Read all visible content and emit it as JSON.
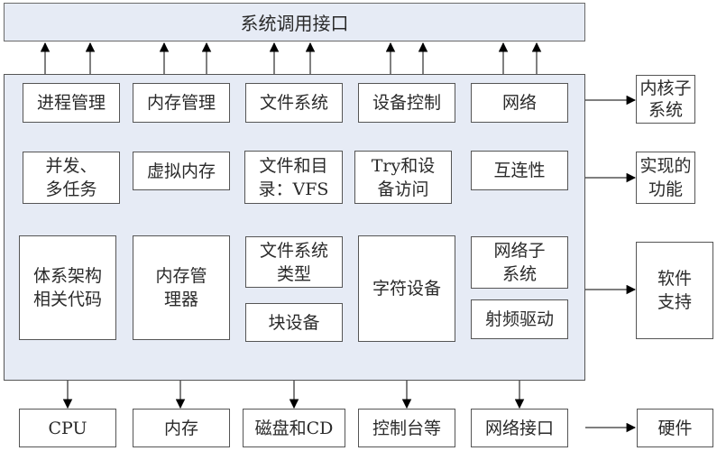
{
  "title": "系统调用接口",
  "kernel_columns": [
    {
      "header": "进程管理",
      "feature": [
        "并发、",
        "多任务"
      ],
      "software": [
        "体系架构",
        "相关代码"
      ],
      "hardware": "CPU"
    },
    {
      "header": "内存管理",
      "feature": [
        "虚拟内存"
      ],
      "software": [
        "内存管",
        "理器"
      ],
      "hardware": "内存"
    },
    {
      "header": "文件系统",
      "feature": [
        "文件和目",
        "录：VFS"
      ],
      "software_top": [
        "文件系统",
        "类型"
      ],
      "software_bottom": "块设备",
      "hardware": "磁盘和CD"
    },
    {
      "header": "设备控制",
      "feature": [
        "Try和设",
        "备访问"
      ],
      "software": [
        "字符设备"
      ],
      "hardware": "控制台等"
    },
    {
      "header": "网络",
      "feature": [
        "互连性"
      ],
      "software_top": [
        "网络子",
        "系统"
      ],
      "software_bottom": "射频驱动",
      "hardware": "网络接口"
    }
  ],
  "row_labels": {
    "subsystem": [
      "内核子",
      "系统"
    ],
    "feature": [
      "实现的",
      "功能"
    ],
    "software": [
      "软件",
      "支持"
    ],
    "hardware": "硬件"
  },
  "colors": {
    "panel_fill": "#e6ebf5",
    "box_fill": "#ffffff",
    "stroke": "#555555"
  }
}
